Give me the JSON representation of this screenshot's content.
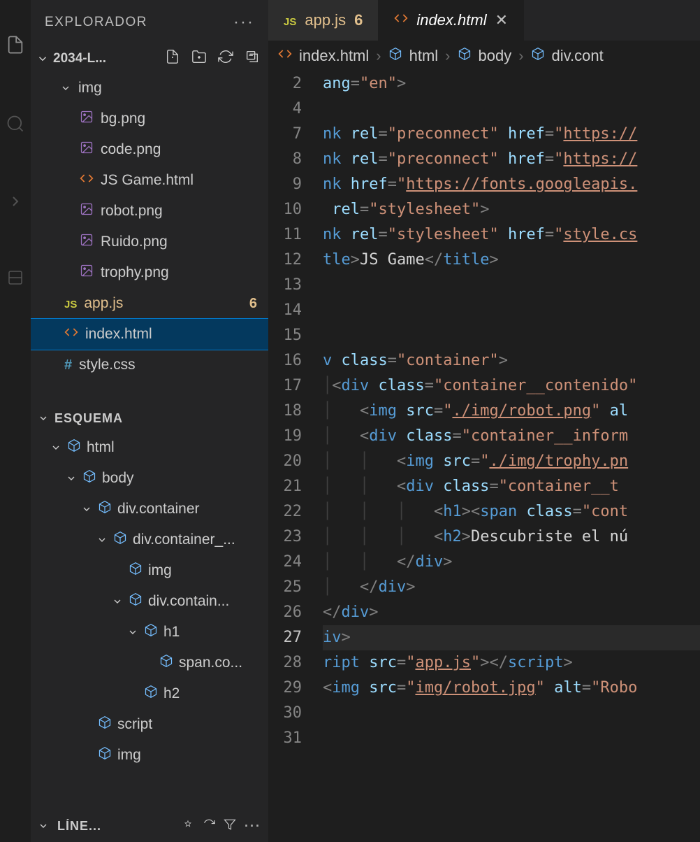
{
  "sidebar": {
    "title": "EXPLORADOR",
    "projectName": "2034-L...",
    "folders": [
      {
        "name": "img",
        "depth": 1
      }
    ],
    "files": [
      {
        "name": "bg.png",
        "type": "image",
        "depth": 2
      },
      {
        "name": "code.png",
        "type": "image",
        "depth": 2
      },
      {
        "name": "JS Game.html",
        "type": "html",
        "depth": 2
      },
      {
        "name": "robot.png",
        "type": "image",
        "depth": 2
      },
      {
        "name": "Ruido.png",
        "type": "image",
        "depth": 2
      },
      {
        "name": "trophy.png",
        "type": "image",
        "depth": 2
      },
      {
        "name": "app.js",
        "type": "js",
        "depth": 1,
        "modified": true,
        "badge": "6"
      },
      {
        "name": "index.html",
        "type": "html",
        "depth": 1,
        "selected": true
      },
      {
        "name": "style.css",
        "type": "css",
        "depth": 1
      }
    ],
    "outlineTitle": "ESQUEMA",
    "outline": [
      {
        "name": "html",
        "depth": 1
      },
      {
        "name": "body",
        "depth": 2
      },
      {
        "name": "div.container",
        "depth": 3
      },
      {
        "name": "div.container_...",
        "depth": 4
      },
      {
        "name": "img",
        "depth": 5,
        "leaf": true
      },
      {
        "name": "div.contain...",
        "depth": 5
      },
      {
        "name": "h1",
        "depth": 6
      },
      {
        "name": "span.co...",
        "depth": 7,
        "leaf": true
      },
      {
        "name": "h2",
        "depth": 6,
        "leaf": true
      },
      {
        "name": "script",
        "depth": 3,
        "leaf": true
      },
      {
        "name": "img",
        "depth": 3,
        "leaf": true
      }
    ],
    "bottomSection": "LÍNE..."
  },
  "tabs": [
    {
      "name": "app.js",
      "type": "js",
      "modified": true,
      "badge": "6"
    },
    {
      "name": "index.html",
      "type": "html",
      "active": true,
      "italic": true
    }
  ],
  "breadcrumb": [
    {
      "label": "index.html",
      "icon": "html"
    },
    {
      "label": "html",
      "icon": "cube"
    },
    {
      "label": "body",
      "icon": "cube"
    },
    {
      "label": "div.cont",
      "icon": "cube"
    }
  ],
  "lines": [
    {
      "no": "2",
      "tokens": [
        [
          "attr",
          "ang"
        ],
        [
          "punc",
          "="
        ],
        [
          "str",
          "\"en\""
        ],
        [
          "punc",
          ">"
        ]
      ]
    },
    {
      "no": "4",
      "tokens": []
    },
    {
      "no": "7",
      "tokens": [
        [
          "tag",
          "nk "
        ],
        [
          "attr",
          "rel"
        ],
        [
          "punc",
          "="
        ],
        [
          "str",
          "\"preconnect\" "
        ],
        [
          "attr",
          "href"
        ],
        [
          "punc",
          "="
        ],
        [
          "str",
          "\""
        ],
        [
          "strlink",
          "https://"
        ]
      ]
    },
    {
      "no": "8",
      "tokens": [
        [
          "tag",
          "nk "
        ],
        [
          "attr",
          "rel"
        ],
        [
          "punc",
          "="
        ],
        [
          "str",
          "\"preconnect\" "
        ],
        [
          "attr",
          "href"
        ],
        [
          "punc",
          "="
        ],
        [
          "str",
          "\""
        ],
        [
          "strlink",
          "https://"
        ]
      ]
    },
    {
      "no": "9",
      "tokens": [
        [
          "tag",
          "nk "
        ],
        [
          "attr",
          "href"
        ],
        [
          "punc",
          "="
        ],
        [
          "str",
          "\""
        ],
        [
          "strlink",
          "https://fonts.googleapis."
        ]
      ]
    },
    {
      "no": "10",
      "tokens": [
        [
          "text",
          " "
        ],
        [
          "attr",
          "rel"
        ],
        [
          "punc",
          "="
        ],
        [
          "str",
          "\"stylesheet\""
        ],
        [
          "punc",
          ">"
        ]
      ]
    },
    {
      "no": "11",
      "tokens": [
        [
          "tag",
          "nk "
        ],
        [
          "attr",
          "rel"
        ],
        [
          "punc",
          "="
        ],
        [
          "str",
          "\"stylesheet\" "
        ],
        [
          "attr",
          "href"
        ],
        [
          "punc",
          "="
        ],
        [
          "str",
          "\""
        ],
        [
          "strlink",
          "style.cs"
        ]
      ]
    },
    {
      "no": "12",
      "tokens": [
        [
          "tag",
          "tle"
        ],
        [
          "punc",
          ">"
        ],
        [
          "text",
          "JS Game"
        ],
        [
          "punc",
          "</"
        ],
        [
          "tag",
          "title"
        ],
        [
          "punc",
          ">"
        ]
      ]
    },
    {
      "no": "13",
      "tokens": []
    },
    {
      "no": "14",
      "tokens": []
    },
    {
      "no": "15",
      "tokens": []
    },
    {
      "no": "16",
      "tokens": [
        [
          "tag",
          "v "
        ],
        [
          "attr",
          "class"
        ],
        [
          "punc",
          "="
        ],
        [
          "str",
          "\"container\""
        ],
        [
          "punc",
          ">"
        ]
      ]
    },
    {
      "no": "17",
      "tokens": [
        [
          "guide",
          "│"
        ],
        [
          "punc",
          "<"
        ],
        [
          "tag",
          "div "
        ],
        [
          "attr",
          "class"
        ],
        [
          "punc",
          "="
        ],
        [
          "str",
          "\"container__contenido\""
        ]
      ]
    },
    {
      "no": "18",
      "tokens": [
        [
          "guide",
          "│   "
        ],
        [
          "punc",
          "<"
        ],
        [
          "tag",
          "img "
        ],
        [
          "attr",
          "src"
        ],
        [
          "punc",
          "="
        ],
        [
          "str",
          "\""
        ],
        [
          "strlink",
          "./img/robot.png"
        ],
        [
          "str",
          "\" "
        ],
        [
          "attr",
          "al"
        ]
      ]
    },
    {
      "no": "19",
      "tokens": [
        [
          "guide",
          "│   "
        ],
        [
          "punc",
          "<"
        ],
        [
          "tag",
          "div "
        ],
        [
          "attr",
          "class"
        ],
        [
          "punc",
          "="
        ],
        [
          "str",
          "\"container__inform"
        ]
      ]
    },
    {
      "no": "20",
      "tokens": [
        [
          "guide",
          "│   │   "
        ],
        [
          "punc",
          "<"
        ],
        [
          "tag",
          "img "
        ],
        [
          "attr",
          "src"
        ],
        [
          "punc",
          "="
        ],
        [
          "str",
          "\""
        ],
        [
          "strlink",
          "./img/trophy.pn"
        ]
      ]
    },
    {
      "no": "21",
      "tokens": [
        [
          "guide",
          "│   │   "
        ],
        [
          "punc",
          "<"
        ],
        [
          "tag",
          "div "
        ],
        [
          "attr",
          "class"
        ],
        [
          "punc",
          "="
        ],
        [
          "str",
          "\"container__t"
        ]
      ]
    },
    {
      "no": "22",
      "tokens": [
        [
          "guide",
          "│   │   │   "
        ],
        [
          "punc",
          "<"
        ],
        [
          "tag",
          "h1"
        ],
        [
          "punc",
          "><"
        ],
        [
          "tag",
          "span "
        ],
        [
          "attr",
          "class"
        ],
        [
          "punc",
          "="
        ],
        [
          "str",
          "\"cont"
        ]
      ]
    },
    {
      "no": "23",
      "tokens": [
        [
          "guide",
          "│   │   │   "
        ],
        [
          "punc",
          "<"
        ],
        [
          "tag",
          "h2"
        ],
        [
          "punc",
          ">"
        ],
        [
          "text",
          "Descubriste el nú"
        ]
      ]
    },
    {
      "no": "24",
      "tokens": [
        [
          "guide",
          "│   │   "
        ],
        [
          "punc",
          "</"
        ],
        [
          "tag",
          "div"
        ],
        [
          "punc",
          ">"
        ]
      ]
    },
    {
      "no": "25",
      "tokens": [
        [
          "guide",
          "│   "
        ],
        [
          "punc",
          "</"
        ],
        [
          "tag",
          "div"
        ],
        [
          "punc",
          ">"
        ]
      ]
    },
    {
      "no": "26",
      "tokens": [
        [
          "guide",
          ""
        ],
        [
          "punc",
          "</"
        ],
        [
          "tag",
          "div"
        ],
        [
          "punc",
          ">"
        ]
      ]
    },
    {
      "no": "27",
      "current": true,
      "tokens": [
        [
          "tag",
          "iv"
        ],
        [
          "punc",
          ">"
        ]
      ]
    },
    {
      "no": "28",
      "tokens": [
        [
          "tag",
          "ript "
        ],
        [
          "attr",
          "src"
        ],
        [
          "punc",
          "="
        ],
        [
          "str",
          "\""
        ],
        [
          "strlink",
          "app.js"
        ],
        [
          "str",
          "\""
        ],
        [
          "punc",
          "></"
        ],
        [
          "tag",
          "script"
        ],
        [
          "punc",
          ">"
        ]
      ]
    },
    {
      "no": "29",
      "tokens": [
        [
          "punc",
          "<"
        ],
        [
          "tag",
          "img "
        ],
        [
          "attr",
          "src"
        ],
        [
          "punc",
          "="
        ],
        [
          "str",
          "\""
        ],
        [
          "strlink",
          "img/robot.jpg"
        ],
        [
          "str",
          "\" "
        ],
        [
          "attr",
          "alt"
        ],
        [
          "punc",
          "="
        ],
        [
          "str",
          "\"Robo"
        ]
      ]
    },
    {
      "no": "30",
      "tokens": []
    },
    {
      "no": "31",
      "tokens": []
    }
  ]
}
